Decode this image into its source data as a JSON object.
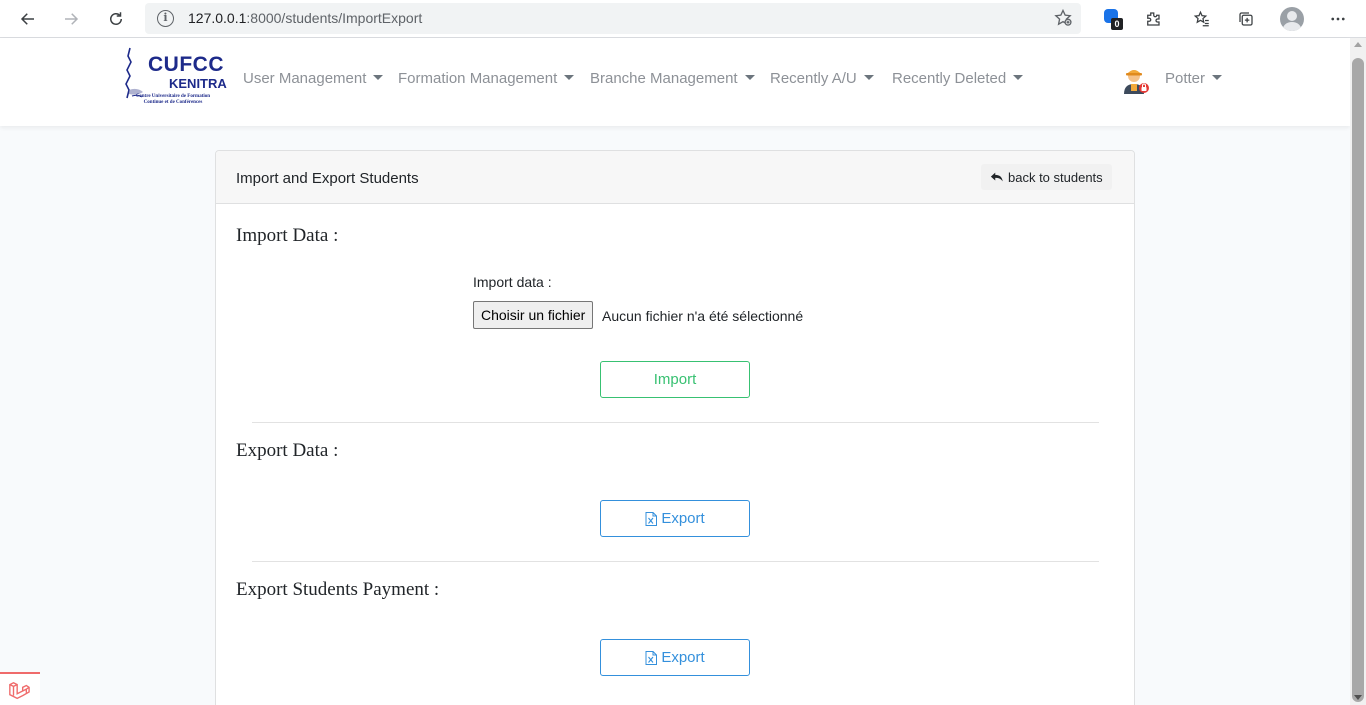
{
  "browser": {
    "url_host": "127.0.0.1",
    "url_path": ":8000/students/ImportExport",
    "extension_badge": "0"
  },
  "navbar": {
    "logo": {
      "line1": "CUFCC",
      "line2": "KENITRA",
      "line3": "Centre Universitaire de Formation Continue et de Conférences"
    },
    "items": [
      {
        "label": "User Management"
      },
      {
        "label": "Formation Management"
      },
      {
        "label": "Branche Management"
      },
      {
        "label": "Recently A/U"
      },
      {
        "label": "Recently Deleted"
      }
    ],
    "user": {
      "name": "Potter"
    }
  },
  "card": {
    "title": "Import and Export Students",
    "back_label": "back to students",
    "import": {
      "heading": "Import Data :",
      "label": "Import data :",
      "file_button": "Choisir un fichier",
      "file_status": "Aucun fichier n'a été sélectionné",
      "button": "Import"
    },
    "export": {
      "heading": "Export Data :",
      "button": "Export"
    },
    "export_payment": {
      "heading": "Export Students Payment :",
      "button": "Export"
    }
  },
  "colors": {
    "success": "#38c172",
    "primary": "#3490dc",
    "brand": "#1d2a8a"
  }
}
